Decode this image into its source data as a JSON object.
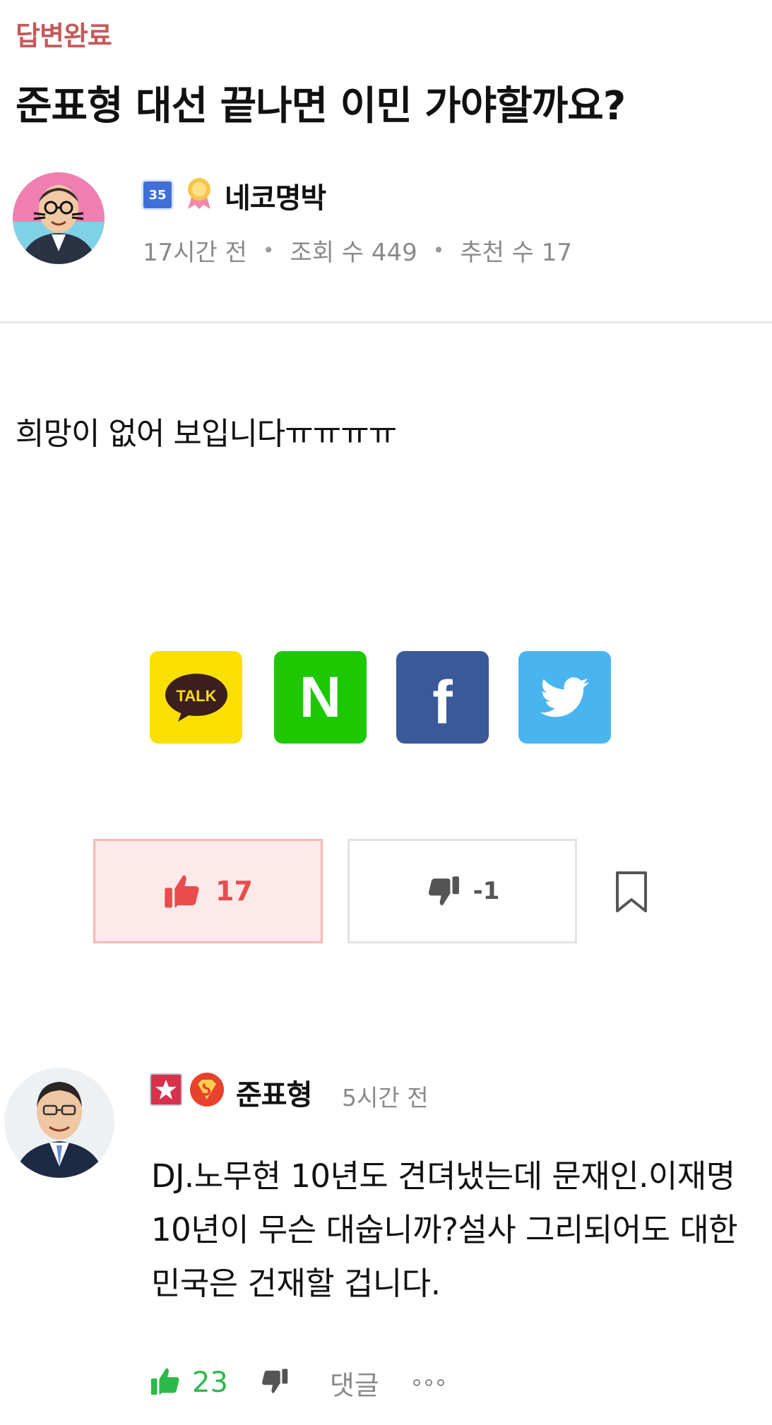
{
  "post": {
    "status": "답변완료",
    "title": "준표형 대선 끝나면 이민 가야할까요?",
    "author": {
      "level": "35",
      "name": "네코명박"
    },
    "meta": {
      "time": "17시간 전",
      "views": "조회 수 449",
      "recommends": "추천 수 17"
    },
    "body": "희망이 없어 보입니다ㅠㅠㅠㅠ"
  },
  "share": {
    "kakao_label": "TALK",
    "naver_label": "N",
    "facebook_label": "f"
  },
  "votes": {
    "up_count": "17",
    "down_count": "-1"
  },
  "comment": {
    "author": "준표형",
    "time": "5시간 전",
    "text": "DJ.노무현 10년도 견뎌냈는데 문재인.이재명 10년이 무슨 대숩니까?설사 그리되어도 대한민국은 건재할 겁니다.",
    "like_count": "23",
    "reply_label": "댓글"
  },
  "colors": {
    "status": "#c45a5a",
    "kakao": "#f9e000",
    "naver": "#1ec800",
    "facebook": "#3b5998",
    "twitter": "#49b5ef",
    "upvote": "#e84c4c",
    "comment_like": "#2db84a"
  }
}
